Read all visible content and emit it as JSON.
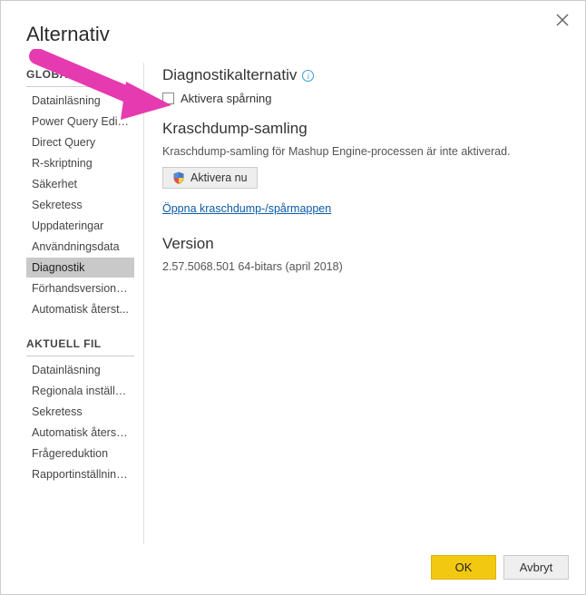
{
  "dialog": {
    "title": "Alternativ",
    "close_tooltip": "Stäng"
  },
  "sidebar": {
    "sections": [
      {
        "header": "GLOBAL",
        "items": [
          {
            "label": "Datainläsning",
            "selected": false
          },
          {
            "label": "Power Query Editor",
            "selected": false
          },
          {
            "label": "Direct Query",
            "selected": false
          },
          {
            "label": "R-skriptning",
            "selected": false
          },
          {
            "label": "Säkerhet",
            "selected": false
          },
          {
            "label": "Sekretess",
            "selected": false
          },
          {
            "label": "Uppdateringar",
            "selected": false
          },
          {
            "label": "Användningsdata",
            "selected": false
          },
          {
            "label": "Diagnostik",
            "selected": true
          },
          {
            "label": "Förhandsversionsf...",
            "selected": false
          },
          {
            "label": "Automatisk återst...",
            "selected": false
          }
        ]
      },
      {
        "header": "AKTUELL FIL",
        "items": [
          {
            "label": "Datainläsning",
            "selected": false
          },
          {
            "label": "Regionala inställni...",
            "selected": false
          },
          {
            "label": "Sekretess",
            "selected": false
          },
          {
            "label": "Automatisk återstä...",
            "selected": false
          },
          {
            "label": "Frågereduktion",
            "selected": false
          },
          {
            "label": "Rapportinställningar",
            "selected": false
          }
        ]
      }
    ]
  },
  "content": {
    "diag_options": {
      "heading": "Diagnostikalternativ",
      "enable_tracing_label": "Aktivera spårning",
      "enable_tracing_checked": false
    },
    "crash_dump": {
      "heading": "Kraschdump-samling",
      "description": "Kraschdump-samling för Mashup Engine-processen är inte aktiverad.",
      "enable_now_label": "Aktivera nu",
      "open_folder_link": "Öppna kraschdump-/spårmappen"
    },
    "version": {
      "heading": "Version",
      "text": "2.57.5068.501 64-bitars (april 2018)"
    }
  },
  "footer": {
    "ok_label": "OK",
    "cancel_label": "Avbryt"
  },
  "annotation": {
    "arrow_color": "#e63ab0"
  }
}
